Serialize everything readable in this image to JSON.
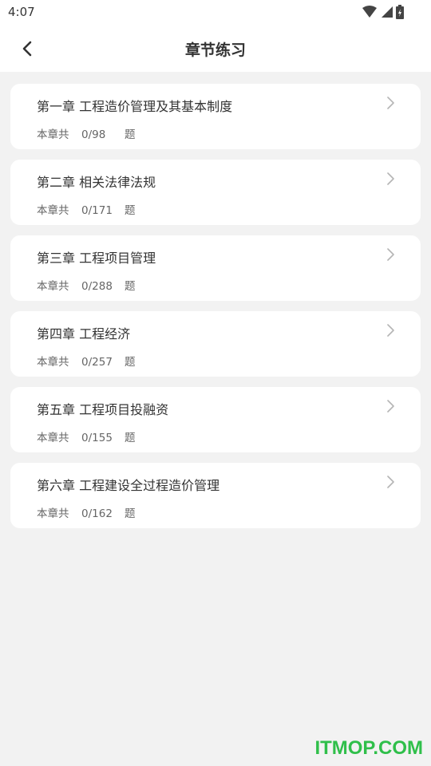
{
  "status_bar": {
    "time": "4:07"
  },
  "header": {
    "title": "章节练习"
  },
  "chapters": [
    {
      "title": "第一章 工程造价管理及其基本制度",
      "prefix": "本章共",
      "count": "0/98",
      "suffix": "题"
    },
    {
      "title": "第二章 相关法律法规",
      "prefix": "本章共",
      "count": "0/171",
      "suffix": "题"
    },
    {
      "title": "第三章 工程项目管理",
      "prefix": "本章共",
      "count": "0/288",
      "suffix": "题"
    },
    {
      "title": "第四章 工程经济",
      "prefix": "本章共",
      "count": "0/257",
      "suffix": "题"
    },
    {
      "title": "第五章 工程项目投融资",
      "prefix": "本章共",
      "count": "0/155",
      "suffix": "题"
    },
    {
      "title": "第六章 工程建设全过程造价管理",
      "prefix": "本章共",
      "count": "0/162",
      "suffix": "题"
    }
  ],
  "watermark": "ITMOP.COM"
}
